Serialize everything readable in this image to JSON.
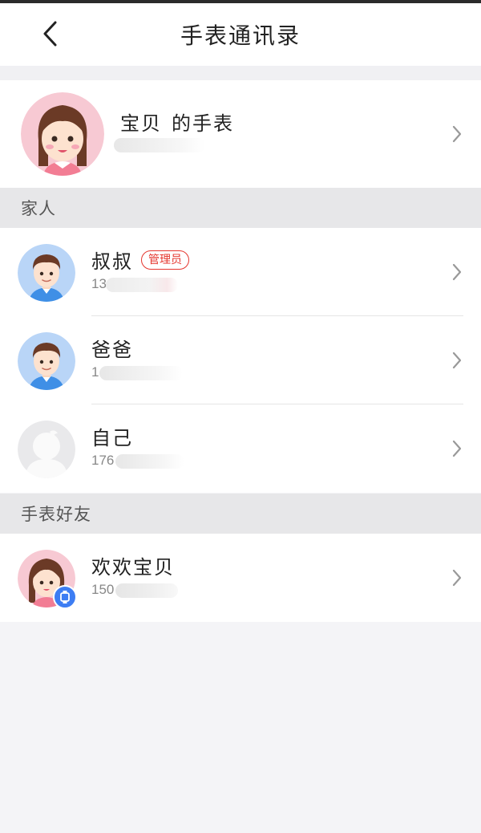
{
  "header": {
    "title": "手表通讯录"
  },
  "watch": {
    "owner": "宝贝",
    "label": "的手表"
  },
  "sections": {
    "family": "家人",
    "friends": "手表好友"
  },
  "family": [
    {
      "name": "叔叔",
      "phone": "13",
      "badge": "管理员"
    },
    {
      "name": "爸爸",
      "phone": "1"
    },
    {
      "name": "自己",
      "phone": "176"
    }
  ],
  "friends": [
    {
      "name": "欢欢宝贝",
      "phone": "150"
    }
  ],
  "colors": {
    "accent": "#e5362e",
    "avatar_blue": "#b9d5f7",
    "avatar_pink": "#f7c9d3",
    "badge_blue": "#3d7df3"
  }
}
